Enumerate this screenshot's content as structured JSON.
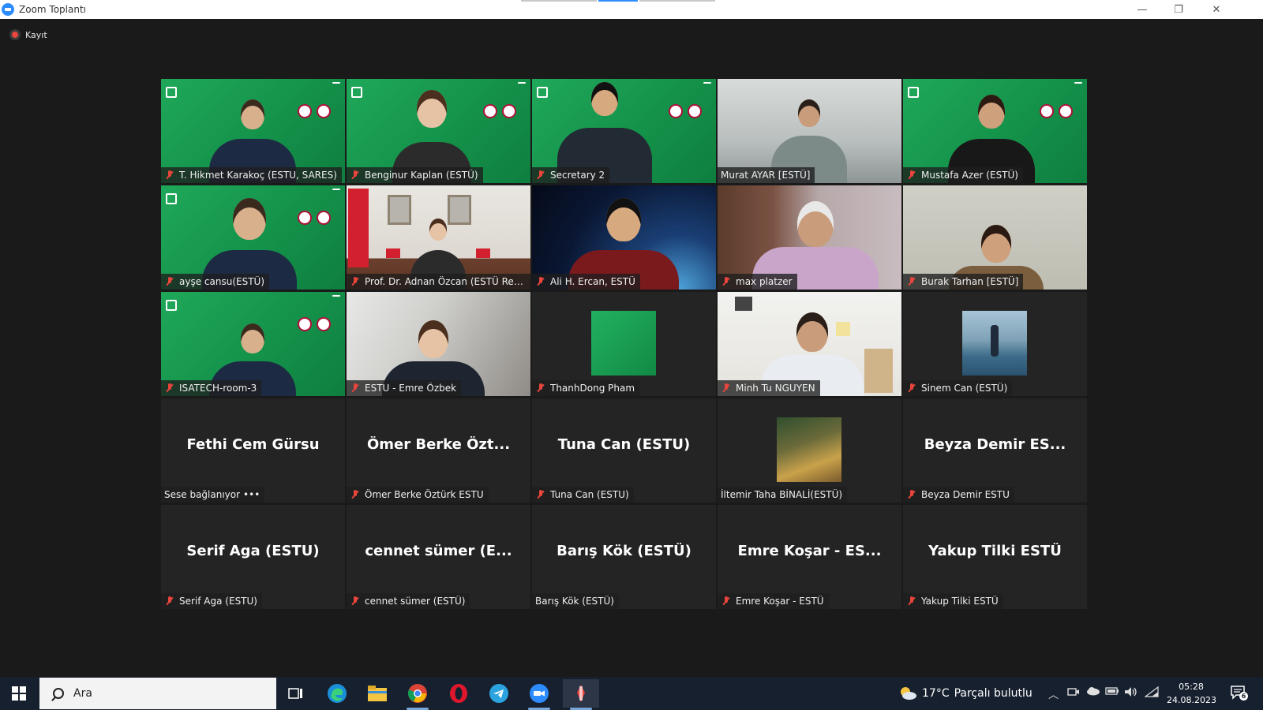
{
  "window": {
    "title": "Zoom Toplantı",
    "minimize": "—",
    "restore": "❐",
    "close": "✕"
  },
  "recording": {
    "label": "Kayıt",
    "color": "#e8453c"
  },
  "tiles": [
    {
      "name": "T. Hikmet Karakoç (ESTU, SARES)",
      "muted": true,
      "view": "banner",
      "bg": "green"
    },
    {
      "name": "Benginur Kaplan (ESTÜ)",
      "muted": true,
      "view": "banner",
      "bg": "green"
    },
    {
      "name": "Secretary 2",
      "muted": true,
      "view": "banner",
      "bg": "green"
    },
    {
      "name": "Murat AYAR [ESTÜ]",
      "muted": false,
      "view": "video",
      "bg": "office"
    },
    {
      "name": "Mustafa Azer (ESTÜ)",
      "muted": true,
      "view": "banner",
      "bg": "green"
    },
    {
      "name": "ayşe cansu(ESTÜ)",
      "muted": true,
      "view": "banner",
      "bg": "green"
    },
    {
      "name": "Prof. Dr. Adnan Özcan (ESTÜ Rect...",
      "muted": true,
      "view": "video",
      "bg": "rector",
      "speaking": true
    },
    {
      "name": "Ali H. Ercan, ESTÜ",
      "muted": true,
      "view": "video",
      "bg": "space"
    },
    {
      "name": "max platzer",
      "muted": true,
      "view": "video",
      "bg": "library"
    },
    {
      "name": "Burak Tarhan [ESTÜ]",
      "muted": true,
      "view": "video",
      "bg": "wall"
    },
    {
      "name": "ISATECH-room-3",
      "muted": true,
      "view": "banner",
      "bg": "green"
    },
    {
      "name": "ESTU - Emre Özbek",
      "muted": true,
      "view": "video",
      "bg": "room"
    },
    {
      "name": "ThanhDong Pham",
      "muted": true,
      "view": "avatar",
      "bg": "dark",
      "avatar": "green-slide"
    },
    {
      "name": "Minh Tu NGUYEN",
      "muted": true,
      "view": "video",
      "bg": "bright"
    },
    {
      "name": "Sinem Can (ESTÜ)",
      "muted": true,
      "view": "avatar",
      "bg": "dark",
      "avatar": "boat-photo"
    },
    {
      "name": "Sese bağlanıyor",
      "muted": false,
      "view": "text",
      "bg": "dark",
      "display": "Fethi Cem Gürsu",
      "connecting": true,
      "dots": "•••"
    },
    {
      "name": "Ömer Berke Öztürk ESTU",
      "muted": true,
      "view": "text",
      "bg": "dark",
      "display": "Ömer Berke Özt..."
    },
    {
      "name": "Tuna Can (ESTU)",
      "muted": true,
      "view": "text",
      "bg": "dark",
      "display": "Tuna Can (ESTU)"
    },
    {
      "name": "İltemir Taha BİNALİ(ESTÜ)",
      "muted": false,
      "view": "avatar",
      "bg": "dark",
      "avatar": "rock-photo"
    },
    {
      "name": "Beyza Demir ESTU",
      "muted": true,
      "view": "text",
      "bg": "dark",
      "display": "Beyza Demir ES..."
    },
    {
      "name": "Serif Aga (ESTU)",
      "muted": true,
      "view": "text",
      "bg": "dark",
      "display": "Serif Aga (ESTU)"
    },
    {
      "name": "cennet sümer (ESTÜ)",
      "muted": true,
      "view": "text",
      "bg": "dark",
      "display": "cennet sümer (E..."
    },
    {
      "name": "Barış Kök (ESTÜ)",
      "muted": false,
      "view": "text",
      "bg": "dark",
      "display": "Barış Kök (ESTÜ)"
    },
    {
      "name": "Emre Koşar - ESTÜ",
      "muted": true,
      "view": "text",
      "bg": "dark",
      "display": "Emre Koşar - ES..."
    },
    {
      "name": "Yakup Tilki ESTÜ",
      "muted": true,
      "view": "text",
      "bg": "dark",
      "display": "Yakup Tilki ESTÜ"
    }
  ],
  "taskbar": {
    "search_placeholder": "Ara",
    "apps": [
      "task-view-icon",
      "edge-icon",
      "file-explorer-icon",
      "chrome-icon",
      "opera-icon",
      "telegram-icon",
      "zoom-icon",
      "app-icon"
    ],
    "weather": {
      "temp": "17°C",
      "desc": "Parçalı bulutlu"
    },
    "time": "05:28",
    "date": "24.08.2023",
    "notifications": "6"
  },
  "colors": {
    "mute_red": "#e8453c",
    "speaker_border": "#e8e872",
    "zoom_blue": "#2d8cff",
    "tile_bg": "#242424",
    "taskbar_bg": "#17202e"
  }
}
